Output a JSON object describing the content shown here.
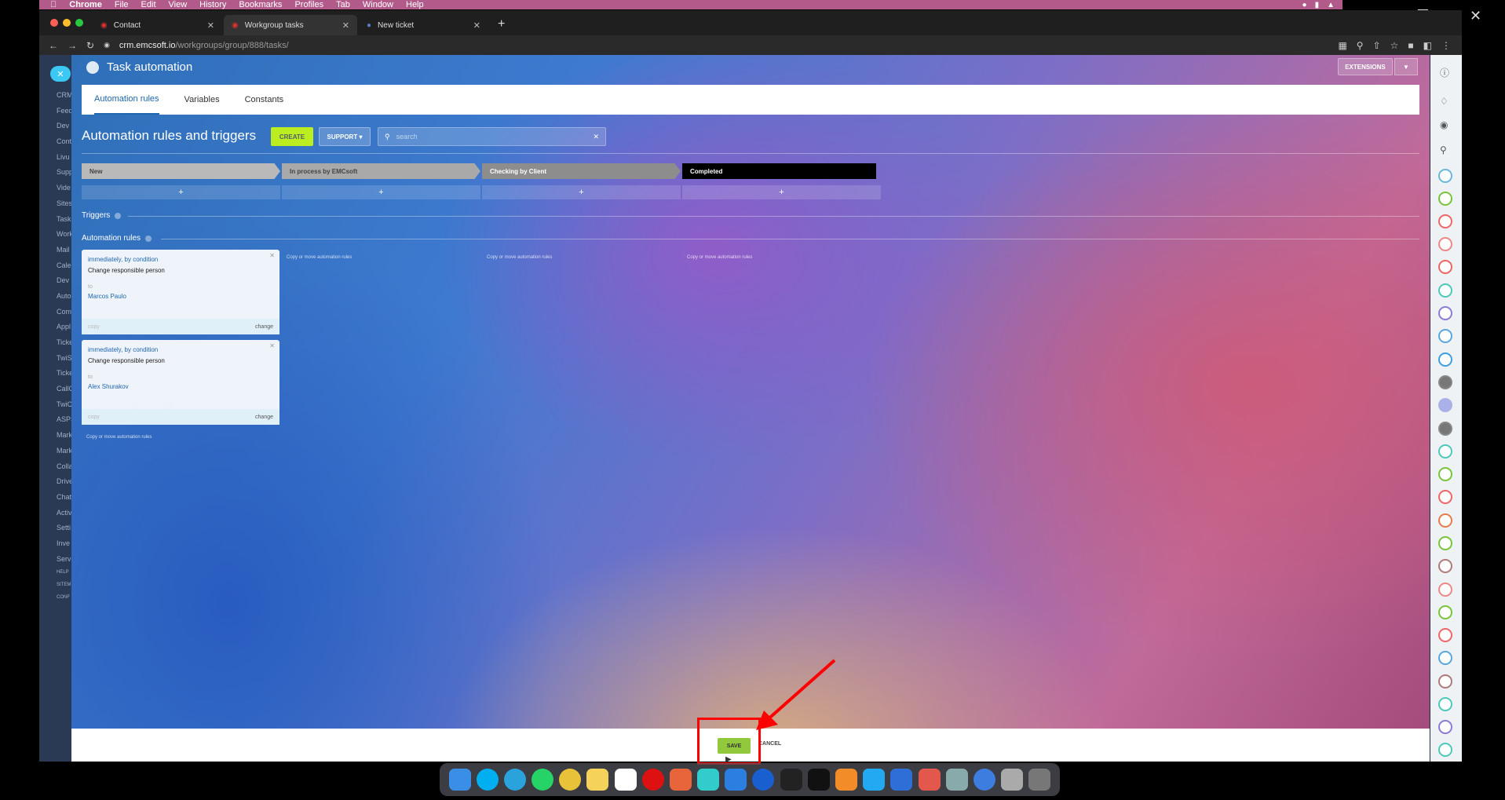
{
  "menubar": {
    "app": "Chrome",
    "items": [
      "File",
      "Edit",
      "View",
      "History",
      "Bookmarks",
      "Profiles",
      "Tab",
      "Window",
      "Help"
    ]
  },
  "browser": {
    "tabs": [
      {
        "label": "Contact",
        "active": false
      },
      {
        "label": "Workgroup tasks",
        "active": true
      },
      {
        "label": "New ticket",
        "active": false
      }
    ],
    "url_host": "crm.emcsoft.io",
    "url_path": "/workgroups/group/888/tasks/"
  },
  "leftnav": {
    "items": [
      "CRM",
      "Feed",
      "Dev",
      "Cont",
      "Livu",
      "Supp",
      "Vide",
      "Sites",
      "Task",
      "Work",
      "Mail",
      "Cale",
      "Dev",
      "Auto",
      "Com",
      "Appl",
      "Ticke",
      "TwiS",
      "Ticke",
      "CallC",
      "TwiC",
      "ASPS",
      "Mark",
      "Mark",
      "Colla",
      "Drive",
      "Chat",
      "Activ",
      "Setti",
      "Inve",
      "Serv",
      "HELP",
      "SITEM",
      "CONF"
    ]
  },
  "header": {
    "title": "Task automation",
    "extensions_label": "EXTENSIONS"
  },
  "tabs": [
    {
      "label": "Automation rules",
      "active": true
    },
    {
      "label": "Variables",
      "active": false
    },
    {
      "label": "Constants",
      "active": false
    }
  ],
  "toolbar": {
    "heading": "Automation rules and triggers",
    "create_label": "CREATE",
    "support_label": "SUPPORT",
    "search_placeholder": "search"
  },
  "stages": [
    {
      "label": "New",
      "color": "#b9b9b9"
    },
    {
      "label": "In process by EMCsoft",
      "color": "#a9a9a9"
    },
    {
      "label": "Checking by Client",
      "color": "#8d8d8d"
    },
    {
      "label": "Completed",
      "color": "#000000"
    }
  ],
  "sections": {
    "triggers": "Triggers",
    "automation_rules": "Automation rules"
  },
  "cards": [
    {
      "condition": "immediately, by condition",
      "name": "Change responsible person",
      "to_label": "to",
      "person": "Marcos Paulo",
      "copy": "copy",
      "change": "change"
    },
    {
      "condition": "immediately, by condition",
      "name": "Change responsible person",
      "to_label": "to",
      "person": "Alex Shurakov",
      "copy": "copy",
      "change": "change"
    }
  ],
  "copy_move_label": "Copy or move automation rules",
  "footer": {
    "save_label": "SAVE",
    "cancel_label": "CANCEL"
  },
  "colors": {
    "accent_green": "#bbed21",
    "link_blue": "#2067b0",
    "highlight_red": "#ff0000"
  }
}
